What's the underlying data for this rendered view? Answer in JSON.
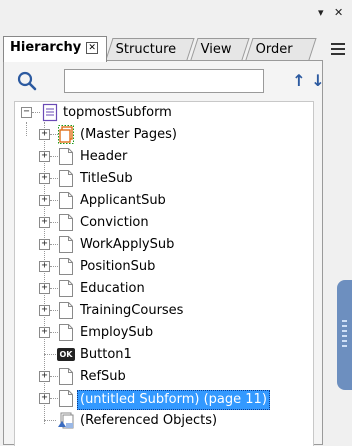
{
  "window": {
    "pin_glyph": "▾",
    "close_glyph": "✕"
  },
  "tabs": [
    {
      "label": "Hierarchy",
      "active": true
    },
    {
      "label": "Structure",
      "active": false
    },
    {
      "label": "View",
      "active": false
    },
    {
      "label": "Order",
      "active": false
    }
  ],
  "tab_close_glyph": "✕",
  "search": {
    "placeholder": "",
    "value": "",
    "up_glyph": "↑",
    "down_glyph": "↓"
  },
  "tree": {
    "root": {
      "label": "topmostSubform",
      "expander": "−"
    },
    "expander_glyph": "+",
    "items": [
      {
        "label": "(Master Pages)",
        "icon": "master-pages-icon"
      },
      {
        "label": "Header",
        "icon": "subform-icon"
      },
      {
        "label": "TitleSub",
        "icon": "subform-icon"
      },
      {
        "label": "ApplicantSub",
        "icon": "subform-icon"
      },
      {
        "label": "Conviction",
        "icon": "subform-icon"
      },
      {
        "label": "WorkApplySub",
        "icon": "subform-icon"
      },
      {
        "label": "PositionSub",
        "icon": "subform-icon"
      },
      {
        "label": "Education",
        "icon": "subform-icon"
      },
      {
        "label": "TrainingCourses",
        "icon": "subform-icon"
      },
      {
        "label": "EmploySub",
        "icon": "subform-icon"
      },
      {
        "label": "Button1",
        "icon": "button-icon",
        "ok_text": "OK"
      },
      {
        "label": "RefSub",
        "icon": "subform-icon"
      },
      {
        "label": "(untitled Subform) (page 11)",
        "icon": "subform-icon",
        "selected": true
      },
      {
        "label": "(Referenced Objects)",
        "icon": "referenced-objects-icon"
      }
    ]
  },
  "colors": {
    "selection": "#3399ff",
    "accent": "#2c5aa0",
    "master_pages": "#e0701a"
  }
}
